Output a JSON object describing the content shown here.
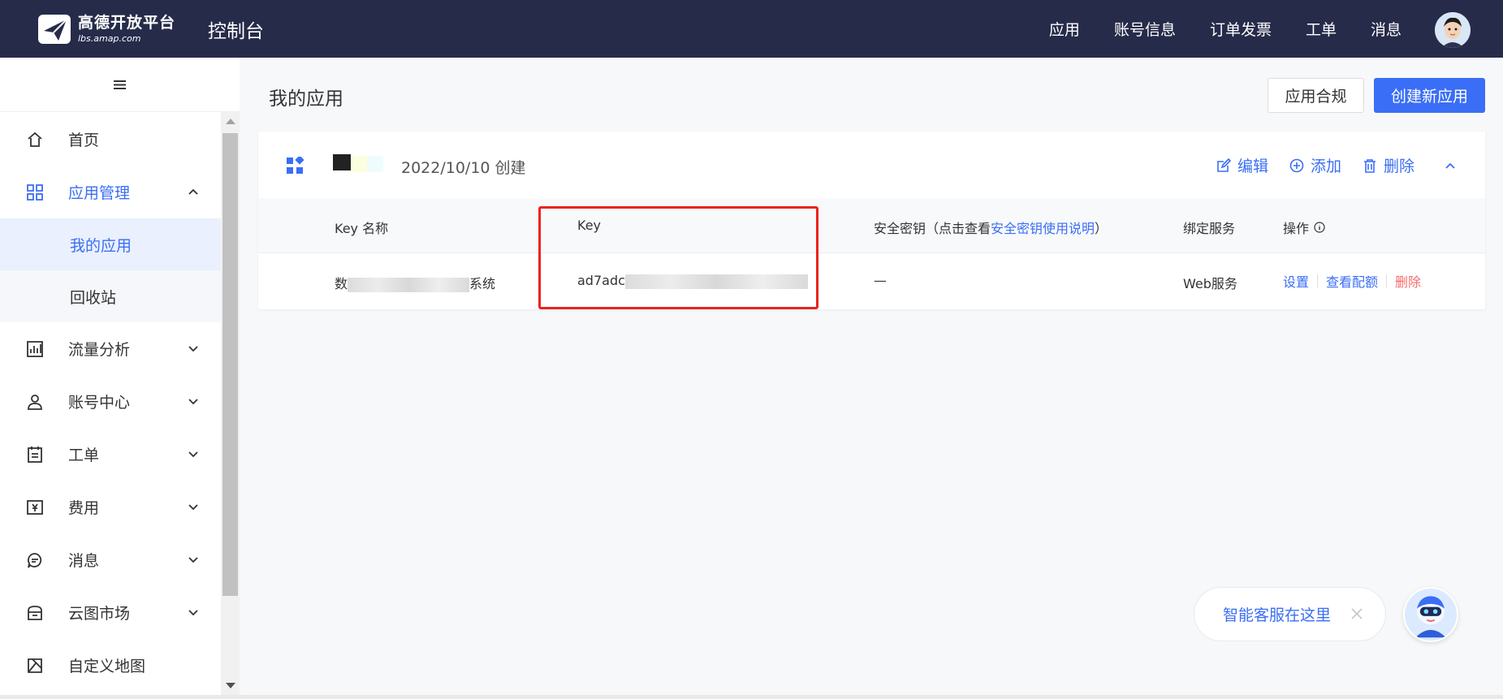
{
  "topbar": {
    "logo_cn": "高德开放平台",
    "logo_en": "lbs.amap.com",
    "console_title": "控制台",
    "nav": [
      "应用",
      "账号信息",
      "订单发票",
      "工单",
      "消息"
    ]
  },
  "sidebar": {
    "toggle_icon": "≡",
    "items": [
      {
        "label": "首页",
        "icon": "home-icon"
      },
      {
        "label": "应用管理",
        "icon": "grid-icon",
        "expanded": true
      },
      {
        "label": "流量分析",
        "icon": "chart-icon"
      },
      {
        "label": "账号中心",
        "icon": "user-icon"
      },
      {
        "label": "工单",
        "icon": "ticket-icon"
      },
      {
        "label": "费用",
        "icon": "yen-icon"
      },
      {
        "label": "消息",
        "icon": "message-icon"
      },
      {
        "label": "云图市场",
        "icon": "store-icon"
      },
      {
        "label": "自定义地图",
        "icon": "custom-map-icon"
      }
    ],
    "subitems": [
      {
        "label": "我的应用",
        "selected": true
      },
      {
        "label": "回收站",
        "selected": false
      }
    ]
  },
  "main": {
    "page_title": "我的应用",
    "btn_compliance": "应用合规",
    "btn_create": "创建新应用"
  },
  "card": {
    "created": "2022/10/10 创建",
    "actions": {
      "edit": "编辑",
      "add": "添加",
      "delete": "删除"
    },
    "columns": {
      "key_name": "Key 名称",
      "key": "Key",
      "secret_prefix": "安全密钥（点击查看",
      "secret_link": "安全密钥使用说明",
      "secret_suffix": "）",
      "service": "绑定服务",
      "ops": "操作"
    },
    "row": {
      "key_name_start": "数",
      "key_name_end": "系统",
      "key_start": "ad7adc",
      "secret": "—",
      "service": "Web服务",
      "op_settings": "设置",
      "op_quota": "查看配额",
      "op_delete": "删除"
    }
  },
  "assistant": {
    "text": "智能客服在这里"
  },
  "colors": {
    "topbar": "#262b4a",
    "accent": "#3a6ef6",
    "danger": "#f56c6c",
    "highlight": "#e8251b"
  }
}
